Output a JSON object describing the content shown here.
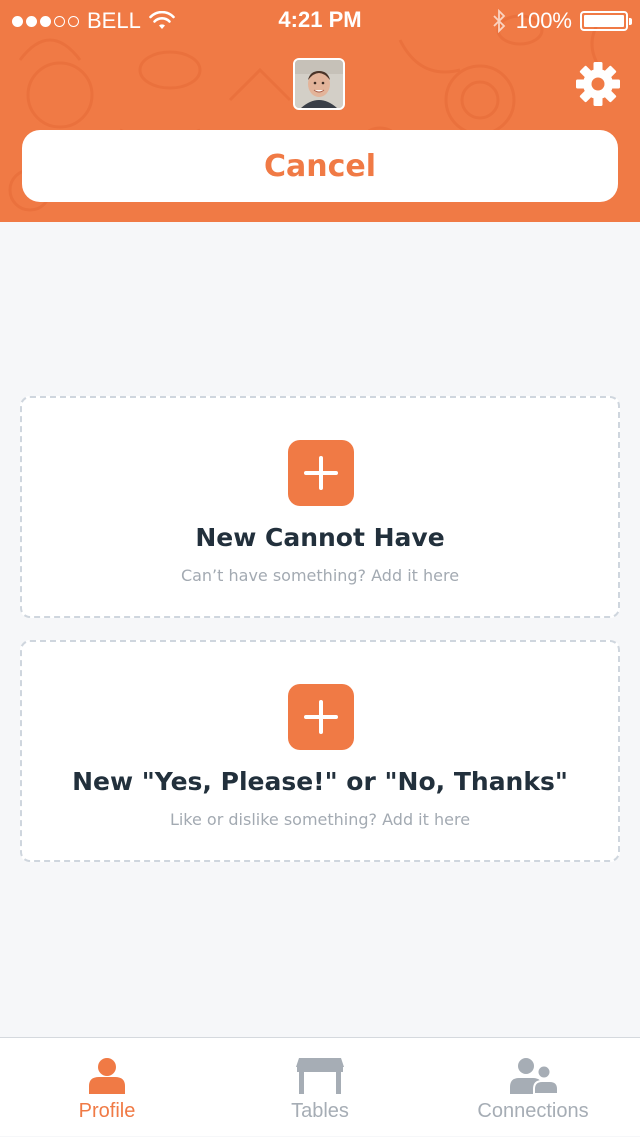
{
  "status_bar": {
    "signal_dots": [
      true,
      true,
      true,
      false,
      false
    ],
    "carrier": "BELL",
    "time": "4:21 PM",
    "battery_percent": "100%",
    "battery_level": 1.0
  },
  "header": {
    "avatar_icon": "user-photo",
    "settings_icon": "gear-icon",
    "cancel_label": "Cancel"
  },
  "cards": [
    {
      "icon": "plus-icon",
      "title": "New Cannot Have",
      "subtitle": "Can’t have something? Add it here"
    },
    {
      "icon": "plus-icon",
      "title": "New \"Yes, Please!\" or \"No, Thanks\"",
      "subtitle": "Like or dislike something? Add it here"
    }
  ],
  "tabs": [
    {
      "label": "Profile",
      "icon": "person-icon",
      "active": true
    },
    {
      "label": "Tables",
      "icon": "table-icon",
      "active": false
    },
    {
      "label": "Connections",
      "icon": "people-icon",
      "active": false
    }
  ],
  "colors": {
    "accent": "#f07a45",
    "background": "#f6f7f9",
    "inactive_tab": "#a6adb5",
    "card_border": "#cfd6de",
    "title_text": "#22303c"
  }
}
